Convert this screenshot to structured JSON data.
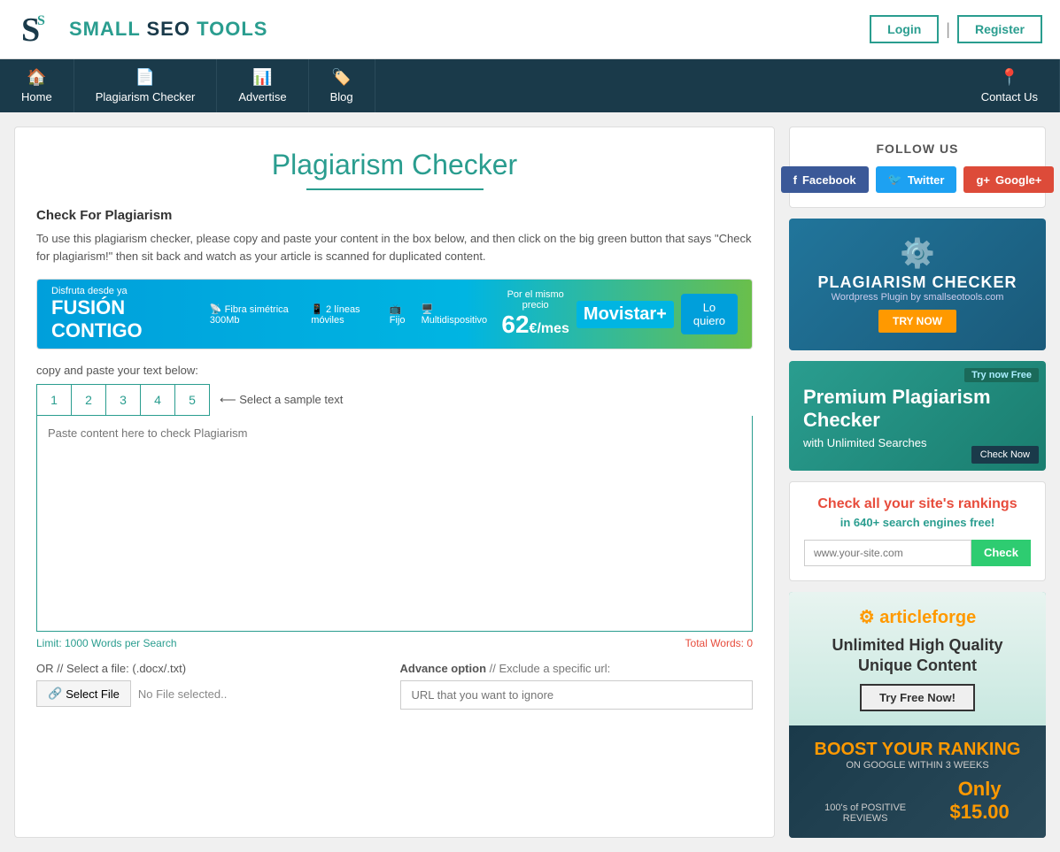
{
  "header": {
    "logo_text": "SMALL SEO TOOLS",
    "login_label": "Login",
    "register_label": "Register",
    "separator": "|"
  },
  "nav": {
    "items": [
      {
        "id": "home",
        "label": "Home",
        "icon": "🏠"
      },
      {
        "id": "plagiarism",
        "label": "Plagiarism Checker",
        "icon": "📄"
      },
      {
        "id": "advertise",
        "label": "Advertise",
        "icon": "📊"
      },
      {
        "id": "blog",
        "label": "Blog",
        "icon": "🏷️"
      },
      {
        "id": "contact",
        "label": "Contact Us",
        "icon": "📍"
      }
    ]
  },
  "main": {
    "title": "Plagiarism Checker",
    "check_heading": "Check For Plagiarism",
    "check_desc": "To use this plagiarism checker, please copy and paste your content in the box below, and then click on the big green button that says \"Check for plagiarism!\" then sit back and watch as your article is scanned for duplicated content.",
    "paste_label": "copy and paste your text below:",
    "sample_tabs": [
      "1",
      "2",
      "3",
      "4",
      "5"
    ],
    "sample_text_label": "⟵ Select a sample text",
    "textarea_placeholder": "Paste content here to check Plagiarism",
    "limit_label": "Limit: 1000 Words per Search",
    "words_label": "Total Words: 0",
    "file_label": "OR // Select a file: (.docx/.txt)",
    "file_btn_label": "Select File",
    "file_name": "No File selected..",
    "advance_label": "Advance option",
    "advance_sub": "// Exclude a specific url:",
    "url_placeholder": "URL that you want to ignore"
  },
  "sidebar": {
    "follow_us": "FOLLOW US",
    "facebook_label": "Facebook",
    "twitter_label": "Twitter",
    "googleplus_label": "Google+",
    "wp_title": "PLAGIARISM CHECKER",
    "wp_sub": "Wordpress Plugin by smallseotools.com",
    "wp_btn": "TRY NOW",
    "premium_try": "Try now Free",
    "premium_title": "Premium Plagiarism Checker",
    "premium_sub": "with Unlimited Searches",
    "premium_check": "Check Now",
    "rankings_title": "Check all your site's rankings",
    "rankings_sub": "in 640+ search engines",
    "rankings_free": "free!",
    "rankings_placeholder": "www.your-site.com",
    "rankings_btn": "Check",
    "article_logo": "articleforge",
    "article_subtitle": "Unlimited High Quality Unique Content",
    "article_try_btn": "Try Free Now!",
    "article_boost": "BOOST YOUR RANKING",
    "article_boost_sub": "ON GOOGLE WITHIN 3 WEEKS",
    "article_positive": "100's of POSITIVE REVIEWS",
    "article_price": "Only $15.00"
  },
  "colors": {
    "teal": "#2a9d8f",
    "navy": "#1a3a4a",
    "red": "#e74c3c",
    "green": "#2ecc71",
    "facebook": "#3b5998",
    "twitter": "#1da1f2",
    "google": "#dd4b39"
  }
}
